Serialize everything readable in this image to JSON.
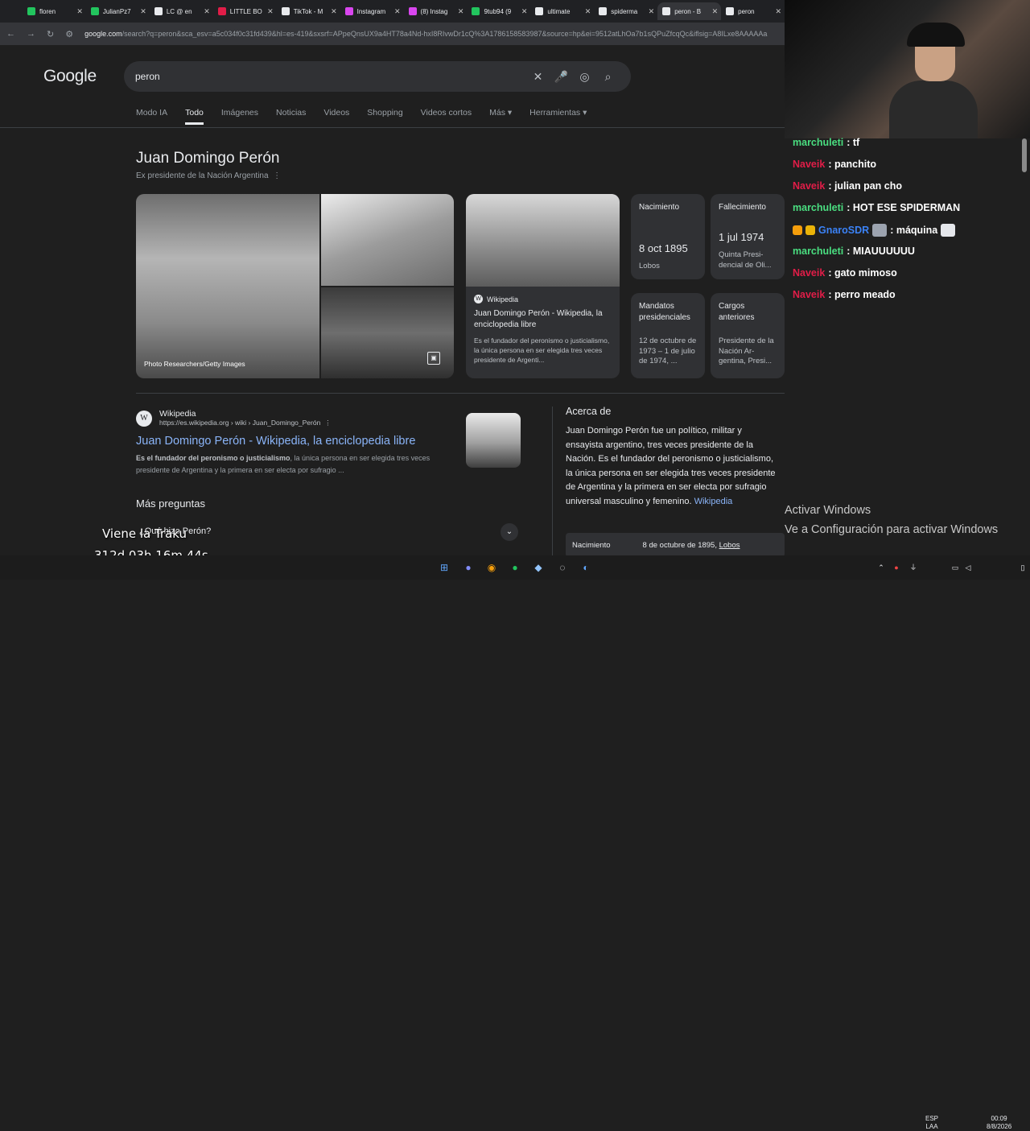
{
  "tabs": [
    {
      "label": "floren",
      "color": "#22c55e"
    },
    {
      "label": "JulianPz7",
      "color": "#22c55e"
    },
    {
      "label": "LC @ en",
      "color": "#e8eaed"
    },
    {
      "label": "LITTLE BO",
      "color": "#e11d48"
    },
    {
      "label": "TikTok - M",
      "color": "#e8eaed"
    },
    {
      "label": "Instagram",
      "color": "#d946ef"
    },
    {
      "label": "(8) Instag",
      "color": "#d946ef"
    },
    {
      "label": "9tub94 (9",
      "color": "#22c55e"
    },
    {
      "label": "ultimate",
      "color": "#e8eaed"
    },
    {
      "label": "spiderma",
      "color": "#e8eaed"
    },
    {
      "label": "peron - B",
      "color": "#e8eaed"
    },
    {
      "label": "peron",
      "color": "#e8eaed"
    }
  ],
  "address": {
    "domain": "google.com",
    "path": "/search?q=peron&sca_esv=a5c034f0c31fd439&hl=es-419&sxsrf=APpeQnsUX9a4HT78a4Nd-hxI8RIvwDr1cQ%3A1786158583987&source=hp&ei=9512atLhOa7b1sQPuZfcqQc&iflsig=A8ILxe8AAAAAa"
  },
  "google": {
    "logo": "Google",
    "query": "peron",
    "filters": [
      "Modo IA",
      "Todo",
      "Imágenes",
      "Noticias",
      "Videos",
      "Shopping",
      "Videos cortos",
      "Más ▾",
      "Herramientas ▾"
    ]
  },
  "knowledge": {
    "title": "Juan Domingo Perón",
    "subtitle": "Ex presidente de la Nación Argentina",
    "photo_credit": "Photo Researchers/Getty Images",
    "wiki_source": "Wikipedia",
    "wiki_title": "Juan Domingo Perón - Wikipedia, la enciclopedia libre",
    "wiki_desc": "Es el fundador del peronismo o justicialismo, la única persona en ser elegida tres veces presidente de Argenti...",
    "facts": [
      {
        "key": "Nacimiento",
        "value": "8 oct 1895",
        "sub": "Lobos"
      },
      {
        "key": "Fallecimiento",
        "value": "1 jul 1974",
        "sub": "Quinta Presi-dencial de Oli..."
      },
      {
        "key": "Mandatos presidenciales",
        "value": "12 de octubre de 1973 – 1 de julio de 1974, ..."
      },
      {
        "key": "Cargos anteriores",
        "value": "Presidente de la Nación Ar-gentina, Presi..."
      }
    ]
  },
  "result": {
    "site_name": "Wikipedia",
    "site_url": "https://es.wikipedia.org › wiki › Juan_Domingo_Perón",
    "title": "Juan Domingo Perón - Wikipedia, la enciclopedia libre",
    "desc_bold": "Es el fundador del peronismo o justicialismo",
    "desc_rest": ", la única persona en ser elegida tres veces presidente de Argentina y la primera en ser electa por sufragio ..."
  },
  "about": {
    "heading": "Acerca de",
    "text": "Juan Domingo Perón  fue un político, militar y ensayista argentino, tres veces presidente de la Nación. Es el fundador del peronismo o justicialismo, la única persona en ser elegida tres veces presidente de Argentina y la primera en ser electa por sufragio universal masculino y femenino.",
    "link": "Wikipedia",
    "birth_label": "Nacimiento",
    "birth_value": "8 de octubre de 1895,",
    "birth_place": "Lobos"
  },
  "more_questions": {
    "heading": "Más preguntas",
    "question": "¿Qué hizo Perón?"
  },
  "stream_overlay": {
    "line1": "Viene la Traku",
    "line2": "312d 03h 16m 44s"
  },
  "chat": [
    {
      "user": "marchuleti",
      "color": "#4ade80",
      "text": ": tf"
    },
    {
      "user": "Naveik",
      "color": "#e11d48",
      "text": ": panchito"
    },
    {
      "user": "Naveik",
      "color": "#e11d48",
      "text": ": julian pan cho"
    },
    {
      "user": "marchuleti",
      "color": "#4ade80",
      "text": ": HOT ESE SPIDERMAN"
    },
    {
      "user": "GnaroSDR",
      "color": "#3b82f6",
      "text": ": máquina"
    },
    {
      "user": "marchuleti",
      "color": "#4ade80",
      "text": ": MIAUUUUUU"
    },
    {
      "user": "Naveik",
      "color": "#e11d48",
      "text": ": gato mimoso"
    },
    {
      "user": "Naveik",
      "color": "#e11d48",
      "text": ": perro meado"
    }
  ],
  "windows": {
    "activate_title": "Activar Windows",
    "activate_desc": "Ve a Configuración para activar Windows",
    "lang_top": "ESP",
    "lang_bottom": "LAA",
    "time": "00:09",
    "date": "8/8/2026"
  }
}
